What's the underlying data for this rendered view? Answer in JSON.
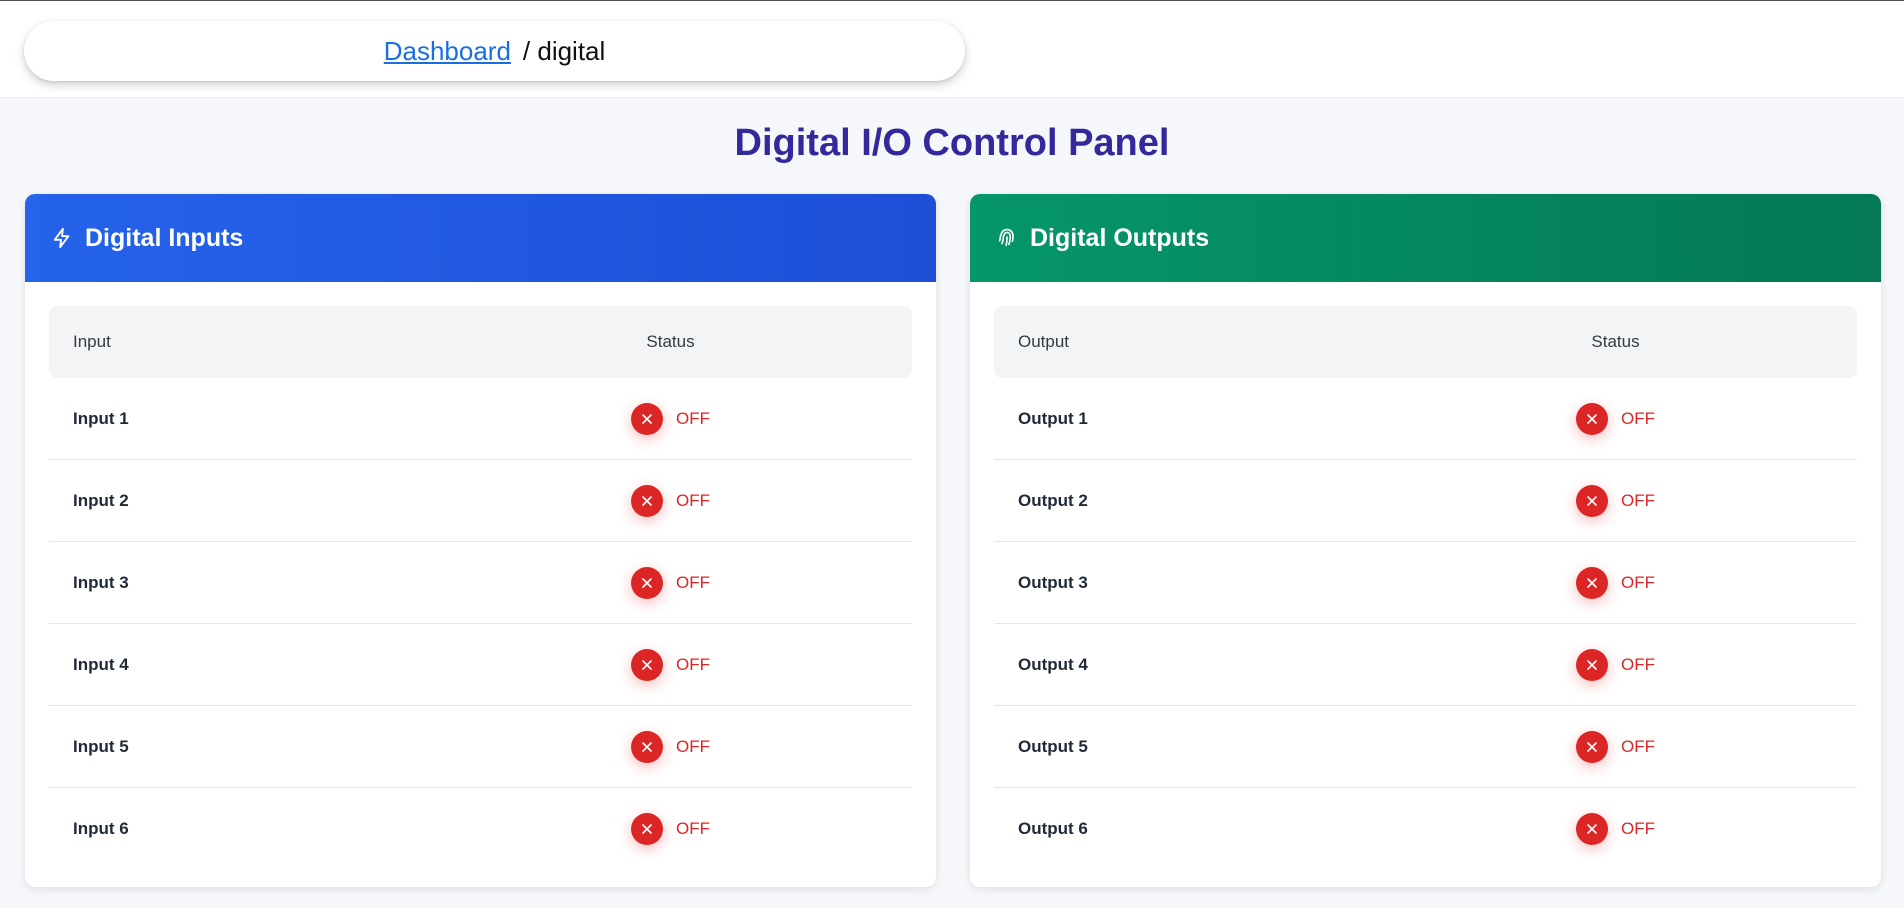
{
  "breadcrumb": {
    "link_label": "Dashboard",
    "current": "/ digital"
  },
  "page_title": "Digital I/O Control Panel",
  "inputs_panel": {
    "title": "Digital Inputs",
    "icon": "lightning-icon",
    "accent": "#2563eb",
    "columns": {
      "name": "Input",
      "status": "Status"
    },
    "rows": [
      {
        "name": "Input 1",
        "status": "OFF"
      },
      {
        "name": "Input 2",
        "status": "OFF"
      },
      {
        "name": "Input 3",
        "status": "OFF"
      },
      {
        "name": "Input 4",
        "status": "OFF"
      },
      {
        "name": "Input 5",
        "status": "OFF"
      },
      {
        "name": "Input 6",
        "status": "OFF"
      }
    ]
  },
  "outputs_panel": {
    "title": "Digital Outputs",
    "icon": "fingerprint-icon",
    "accent": "#059669",
    "columns": {
      "name": "Output",
      "status": "Status"
    },
    "rows": [
      {
        "name": "Output 1",
        "status": "OFF"
      },
      {
        "name": "Output 2",
        "status": "OFF"
      },
      {
        "name": "Output 3",
        "status": "OFF"
      },
      {
        "name": "Output 4",
        "status": "OFF"
      },
      {
        "name": "Output 5",
        "status": "OFF"
      },
      {
        "name": "Output 6",
        "status": "OFF"
      }
    ]
  },
  "colors": {
    "off_status": "#dc2626",
    "title": "#33289c"
  }
}
